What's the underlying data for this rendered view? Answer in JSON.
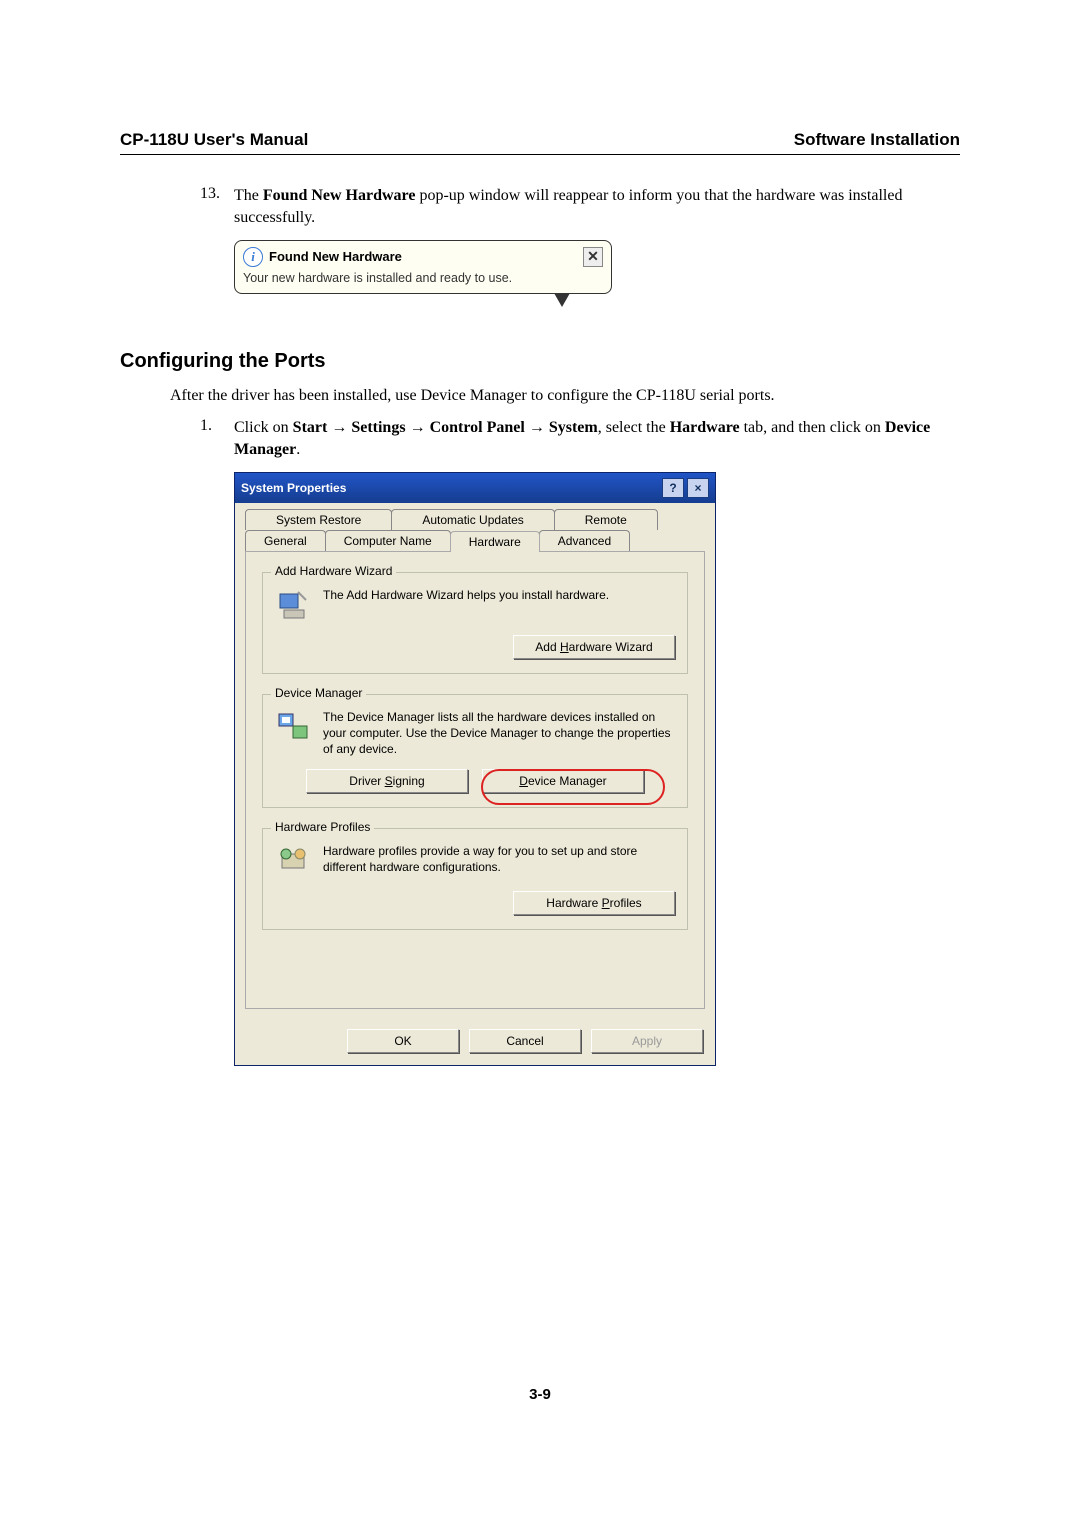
{
  "header": {
    "left": "CP-118U  User's  Manual",
    "right": "Software  Installation"
  },
  "step13": {
    "num": "13.",
    "text_prefix": "The ",
    "bold1": "Found New Hardware",
    "text_suffix": " pop-up window will reappear to inform you that the hardware was installed successfully."
  },
  "balloon": {
    "title": "Found New Hardware",
    "body": "Your new hardware is installed and ready to use."
  },
  "section_heading": "Configuring the Ports",
  "intro": "After the driver has been installed, use Device Manager to configure the CP-118U serial ports.",
  "step1": {
    "num": "1.",
    "p1": "Click on ",
    "b1": "Start",
    "arrow": " → ",
    "b2": "Settings",
    "b3": "Control Panel",
    "b4": "System",
    "p2": ", select the ",
    "b5": "Hardware",
    "p3": " tab, and then click on ",
    "b6": "Device Manager",
    "p4": "."
  },
  "dialog": {
    "title": "System Properties",
    "help": "?",
    "close": "×",
    "tabs_row1": [
      "System Restore",
      "Automatic Updates",
      "Remote"
    ],
    "tabs_row2": [
      "General",
      "Computer Name",
      "Hardware",
      "Advanced"
    ],
    "group1": {
      "legend": "Add Hardware Wizard",
      "text": "The Add Hardware Wizard helps you install hardware.",
      "btn": "Add Hardware Wizard",
      "btn_ul": "H"
    },
    "group2": {
      "legend": "Device Manager",
      "text": "The Device Manager lists all the hardware devices installed on your computer. Use the Device Manager to change the properties of any device.",
      "btn1": "Driver Signing",
      "btn1_ul": "S",
      "btn2": "Device Manager",
      "btn2_ul": "D"
    },
    "group3": {
      "legend": "Hardware Profiles",
      "text": "Hardware profiles provide a way for you to set up and store different hardware configurations.",
      "btn": "Hardware Profiles",
      "btn_ul": "P"
    },
    "footer": {
      "ok": "OK",
      "cancel": "Cancel",
      "apply": "Apply"
    }
  },
  "page_number": "3-9"
}
